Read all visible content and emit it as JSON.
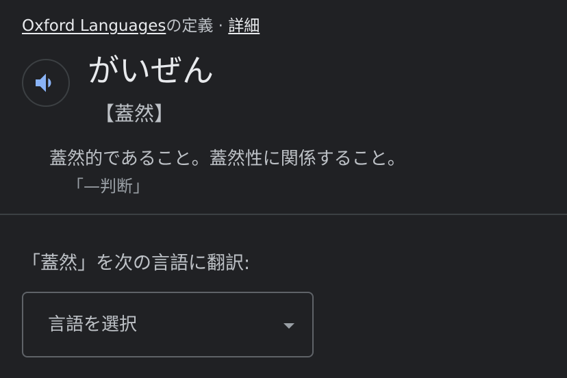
{
  "source": {
    "provider_link": "Oxford Languages",
    "suffix": "の定義 · ",
    "details_link": "詳細"
  },
  "entry": {
    "pronounce_icon": "speaker-icon",
    "headword": "がいぜん",
    "kanji": "【蓋然】",
    "definition": "蓋然的であること。蓋然性に関係すること。",
    "example": "「—判断」"
  },
  "translate": {
    "label": "「蓋然」を次の言語に翻訳:",
    "select_value": "言語を選択",
    "select_icon": "dropdown-caret-icon"
  },
  "colors": {
    "background": "#202124",
    "accent_icon": "#8ab4f8",
    "divider": "#3c4043"
  }
}
